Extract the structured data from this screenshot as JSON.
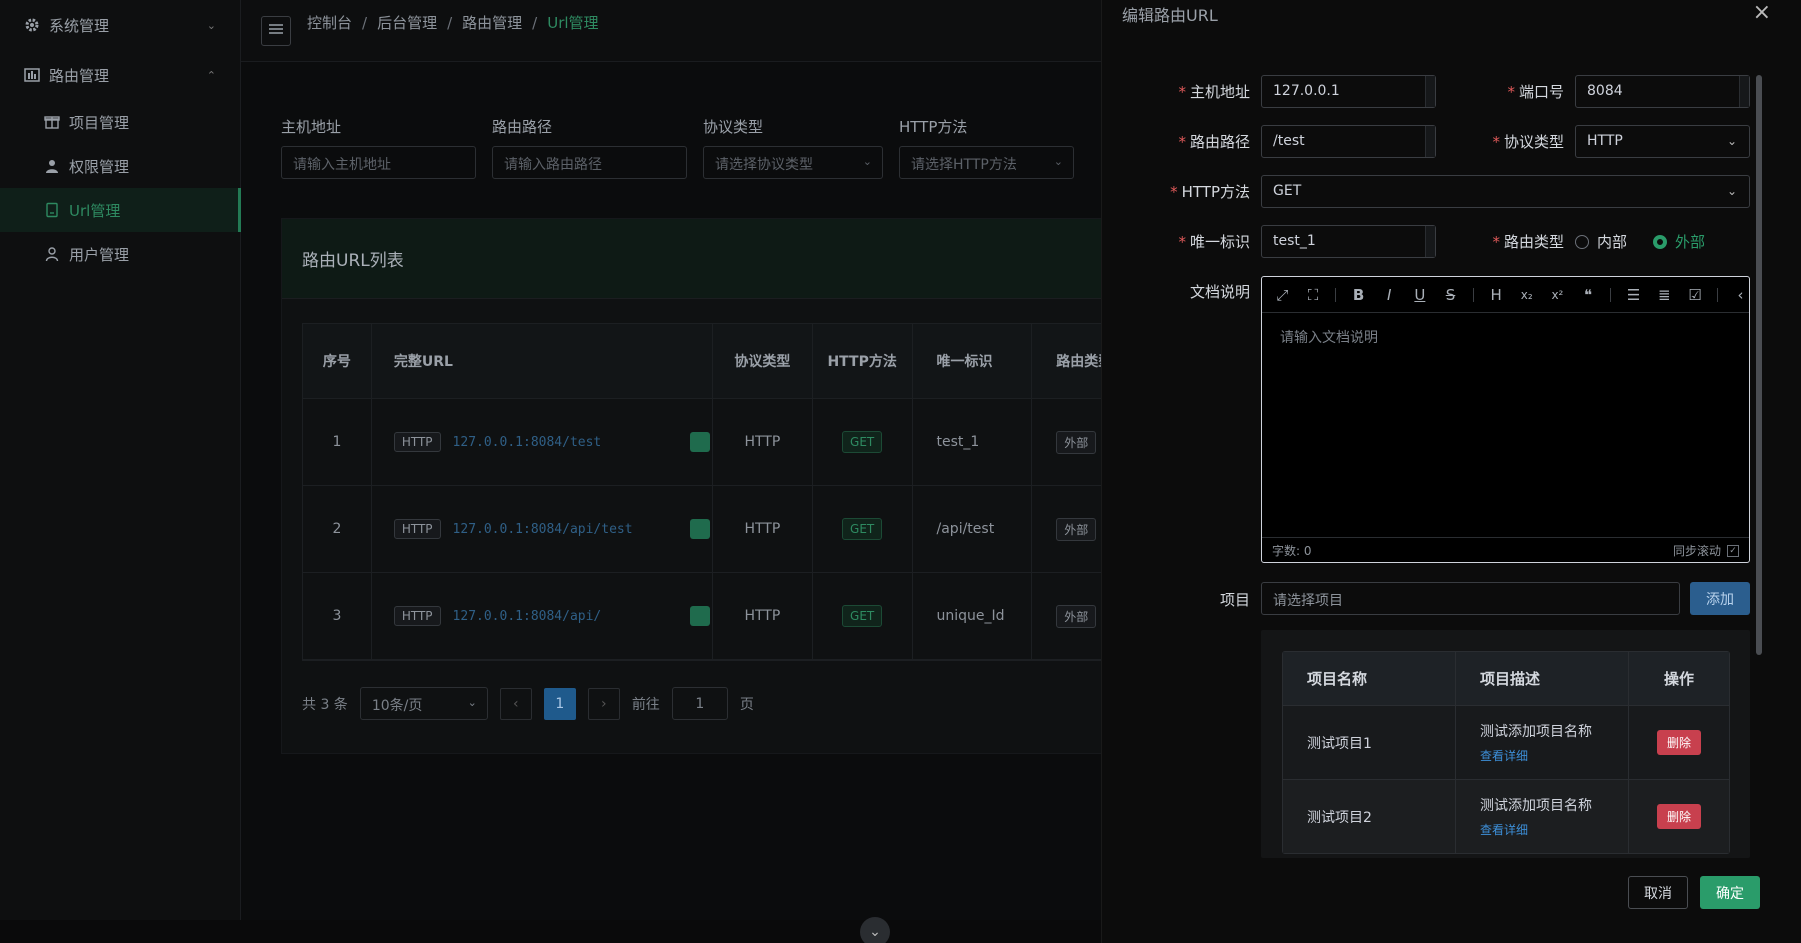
{
  "sidebar": {
    "groups": [
      {
        "label": "系统管理",
        "icon": "gear-icon",
        "expanded": false
      },
      {
        "label": "路由管理",
        "icon": "chart-icon",
        "expanded": true
      }
    ],
    "items": [
      {
        "label": "项目管理",
        "icon": "package-icon"
      },
      {
        "label": "权限管理",
        "icon": "user-icon"
      },
      {
        "label": "Url管理",
        "icon": "document-icon",
        "active": true
      },
      {
        "label": "用户管理",
        "icon": "person-icon"
      }
    ]
  },
  "breadcrumb": [
    "控制台",
    "后台管理",
    "路由管理",
    "Url管理"
  ],
  "filters": [
    {
      "label": "主机地址",
      "placeholder": "请输入主机地址"
    },
    {
      "label": "路由路径",
      "placeholder": "请输入路由路径"
    },
    {
      "label": "协议类型",
      "placeholder": "请选择协议类型"
    },
    {
      "label": "HTTP方法",
      "placeholder": "请选择HTTP方法"
    }
  ],
  "list": {
    "title": "路由URL列表",
    "columns": [
      "序号",
      "完整URL",
      "协议类型",
      "HTTP方法",
      "唯一标识",
      "路由类型"
    ],
    "rows": [
      {
        "no": "1",
        "proto_tag": "HTTP",
        "url": "127.0.0.1:8084/test",
        "proto": "HTTP",
        "method": "GET",
        "uid": "test_1",
        "type": "外部"
      },
      {
        "no": "2",
        "proto_tag": "HTTP",
        "url": "127.0.0.1:8084/api/test",
        "proto": "HTTP",
        "method": "GET",
        "uid": "/api/test",
        "type": "外部"
      },
      {
        "no": "3",
        "proto_tag": "HTTP",
        "url": "127.0.0.1:8084/api/",
        "proto": "HTTP",
        "method": "GET",
        "uid": "unique_Id",
        "type": "外部"
      }
    ],
    "pager": {
      "total": "共 3 条",
      "size": "10条/页",
      "current": "1",
      "goto_label": "前往",
      "goto_value": "1",
      "page_label": "页"
    }
  },
  "drawer": {
    "title": "编辑路由URL",
    "host_label": "主机地址",
    "host_value": "127.0.0.1",
    "port_label": "端口号",
    "port_value": "8084",
    "path_label": "路由路径",
    "path_value": "/test",
    "proto_label": "协议类型",
    "proto_value": "HTTP",
    "method_label": "HTTP方法",
    "method_value": "GET",
    "uid_label": "唯一标识",
    "uid_value": "test_1",
    "rtype_label": "路由类型",
    "rtype_internal": "内部",
    "rtype_external": "外部",
    "rtype_selected": "外部",
    "doc_label": "文档说明",
    "doc_placeholder": "请输入文档说明",
    "word_count": "字数: 0",
    "sync_scroll": "同步滚动",
    "project_label": "项目",
    "project_placeholder": "请选择项目",
    "add_label": "添加",
    "project_columns": [
      "项目名称",
      "项目描述",
      "操作"
    ],
    "projects": [
      {
        "name": "测试项目1",
        "desc": "测试添加项目名称",
        "link": "查看详细",
        "action": "删除"
      },
      {
        "name": "测试项目2",
        "desc": "测试添加项目名称",
        "link": "查看详细",
        "action": "删除"
      }
    ],
    "cancel_label": "取消",
    "ok_label": "确定"
  },
  "colors": {
    "accent": "#2a9c6a",
    "link": "#3d8fd8",
    "danger": "#c8404e",
    "primary": "#2b5e8e"
  }
}
